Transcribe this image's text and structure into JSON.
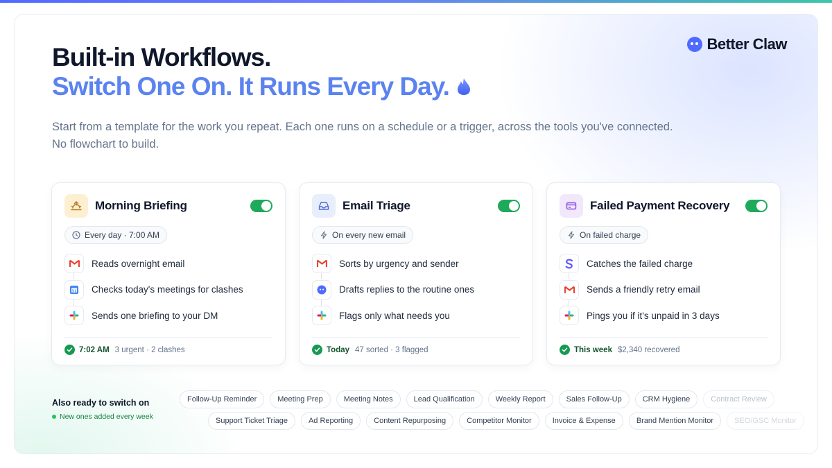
{
  "brand": {
    "name": "Better Claw"
  },
  "hero": {
    "title_line1": "Built-in Workflows.",
    "title_line2": "Switch One On. It Runs Every Day.",
    "subtitle": "Start from a template for the work you repeat. Each one runs on a schedule or a trigger, across the tools you've connected. No flowchart to build."
  },
  "cards": [
    {
      "title": "Morning Briefing",
      "icon": "sunrise-icon",
      "enabled": true,
      "trigger": "Every day · 7:00 AM",
      "trigger_icon": "clock-icon",
      "steps": [
        {
          "icon": "gmail-icon",
          "text": "Reads overnight email"
        },
        {
          "icon": "calendar-icon",
          "text": "Checks today's meetings for clashes"
        },
        {
          "icon": "slack-icon",
          "text": "Sends one briefing to your DM"
        }
      ],
      "footer": {
        "strong": "7:02 AM",
        "muted": "3 urgent · 2 clashes"
      }
    },
    {
      "title": "Email Triage",
      "icon": "inbox-icon",
      "enabled": true,
      "trigger": "On every new email",
      "trigger_icon": "bolt-icon",
      "steps": [
        {
          "icon": "gmail-icon",
          "text": "Sorts by urgency and sender"
        },
        {
          "icon": "better-claw-icon",
          "text": "Drafts replies to the routine ones"
        },
        {
          "icon": "slack-icon",
          "text": "Flags only what needs you"
        }
      ],
      "footer": {
        "strong": "Today",
        "muted": "47 sorted · 3 flagged"
      }
    },
    {
      "title": "Failed Payment Recovery",
      "icon": "credit-card-icon",
      "enabled": true,
      "trigger": "On failed charge",
      "trigger_icon": "bolt-icon",
      "steps": [
        {
          "icon": "stripe-icon",
          "text": "Catches the failed charge"
        },
        {
          "icon": "gmail-icon",
          "text": "Sends a friendly retry email"
        },
        {
          "icon": "slack-icon",
          "text": "Pings you if it's unpaid in 3 days"
        }
      ],
      "footer": {
        "strong": "This week",
        "muted": "$2,340 recovered"
      }
    }
  ],
  "also": {
    "title": "Also ready to switch on",
    "subtitle": "New ones added every week",
    "row1": [
      "Follow-Up Reminder",
      "Meeting Prep",
      "Meeting Notes",
      "Lead Qualification",
      "Weekly Report",
      "Sales Follow-Up",
      "CRM Hygiene",
      "Contract Review"
    ],
    "row2": [
      "Support Ticket Triage",
      "Ad Reporting",
      "Content Repurposing",
      "Competitor Monitor",
      "Invoice & Expense",
      "Brand Mention Monitor",
      "SEO/GSC Monitor"
    ]
  },
  "colors": {
    "accent": "#5b83f0",
    "brand": "#4f6bff",
    "toggle_on": "#1faa5b",
    "success": "#169a50"
  }
}
